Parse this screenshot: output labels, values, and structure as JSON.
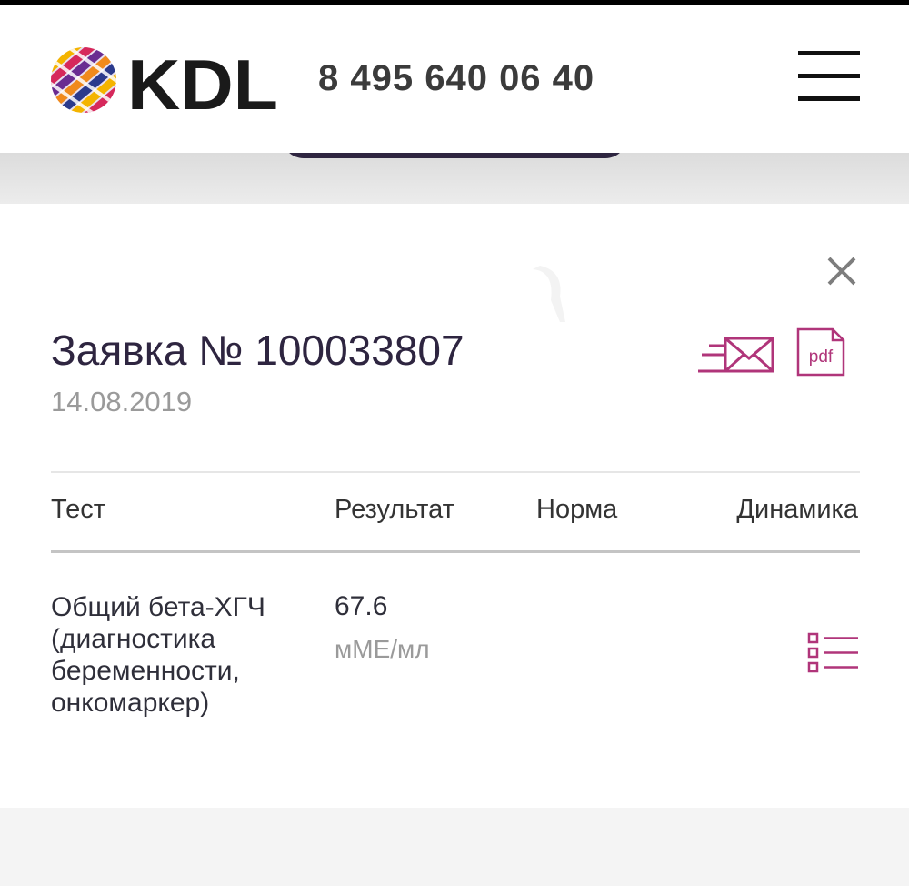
{
  "header": {
    "logo_text": "KDL",
    "phone": "8 495 640 06 40",
    "menu_icon": "hamburger-menu-icon"
  },
  "modal": {
    "close_icon": "close-icon",
    "title": "Заявка № 100033807",
    "date": "14.08.2019",
    "actions": {
      "email_icon": "send-email-icon",
      "pdf_label": "pdf"
    },
    "table": {
      "columns": [
        "Тест",
        "Результат",
        "Норма",
        "Динамика"
      ],
      "rows": [
        {
          "test": "Общий бета-ХГЧ (диагностика беременности, онкомаркер)",
          "value": "67.6",
          "unit": "мМЕ/мл",
          "norm": "",
          "dynamics_icon": "dynamics-list-icon"
        }
      ]
    }
  },
  "colors": {
    "brand_dark": "#2e2540",
    "accent_magenta": "#b0357a",
    "muted_text": "#9a9a9a"
  }
}
